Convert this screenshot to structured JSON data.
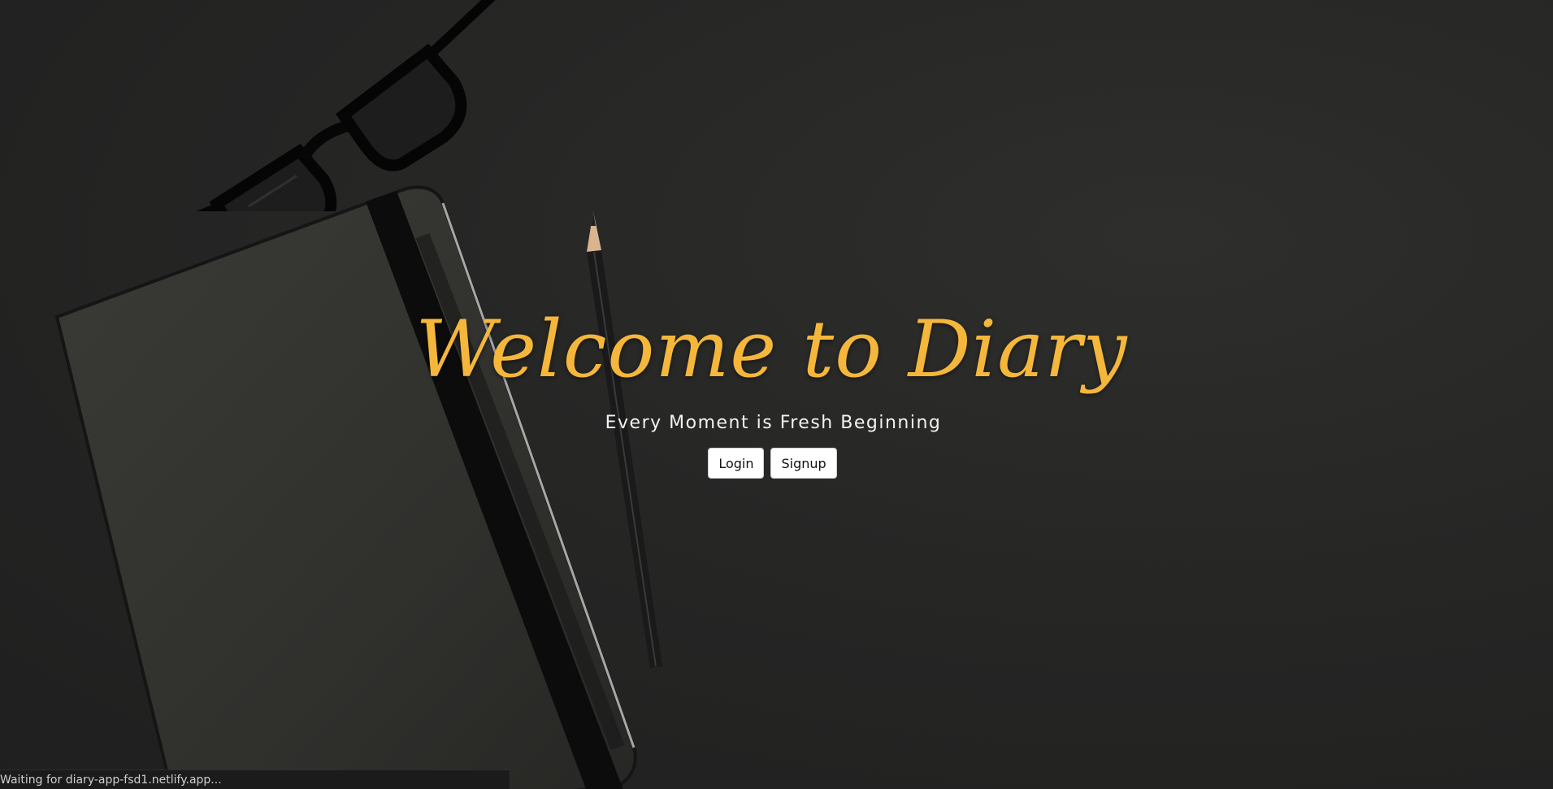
{
  "hero": {
    "title": "Welcome to Diary",
    "subtitle": "Every Moment is Fresh Beginning",
    "login_label": "Login",
    "signup_label": "Signup"
  },
  "status_bar": {
    "text": "Waiting for diary-app-fsd1.netlify.app..."
  },
  "colors": {
    "background": "#262626",
    "title": "#f5b73b",
    "subtitle": "#f2f2f2",
    "button_bg": "#ffffff"
  },
  "decor": [
    "eyeglasses-image",
    "notebook-image",
    "pencil-image"
  ]
}
